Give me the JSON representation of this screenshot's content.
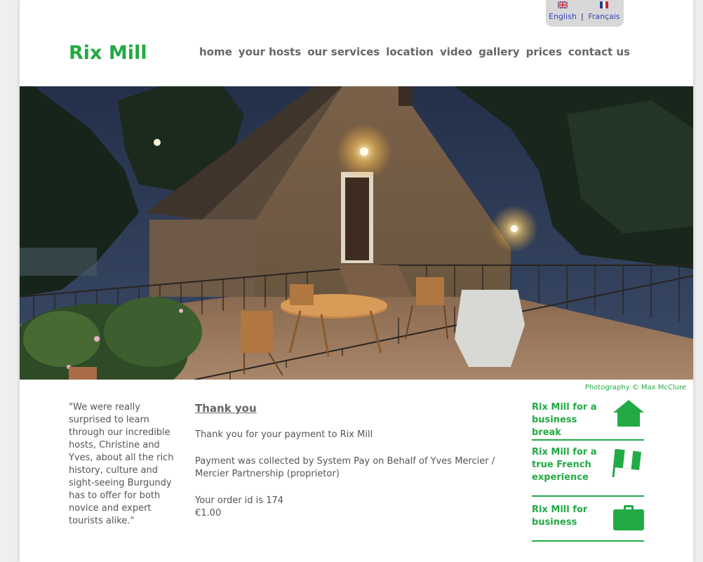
{
  "language": {
    "english": "English",
    "separator": "|",
    "francais": "Français"
  },
  "logo": "Rix Mill",
  "nav": [
    "home",
    "your hosts",
    "our services",
    "location",
    "video",
    "gallery",
    "prices",
    "contact us"
  ],
  "hero": {
    "credit": "Photography © Max McClure"
  },
  "quote": "\"We were really surprised to learn through our incredible hosts, Christine and Yves, about all the rich history, culture and sight-seeing Burgundy has to offer for both novice and expert tourists alike.\"",
  "main": {
    "heading": "Thank you",
    "line1": "Thank you for your payment to Rix Mill",
    "line2": "Payment was collected by System Pay on Behalf of Yves Mercier / Mercier Partnership (proprietor)",
    "order": "Your order id is 174",
    "amount": "€1.00"
  },
  "sidebar": [
    {
      "label": "Rix Mill for a business break",
      "icon": "house-icon"
    },
    {
      "label": "Rix Mill for a true French experience",
      "icon": "flag-icon"
    },
    {
      "label": "Rix Mill for business",
      "icon": "briefcase-icon"
    }
  ],
  "colors": {
    "brand_green": "#22aa44",
    "nav_grey": "#666666",
    "text_grey": "#555555"
  }
}
